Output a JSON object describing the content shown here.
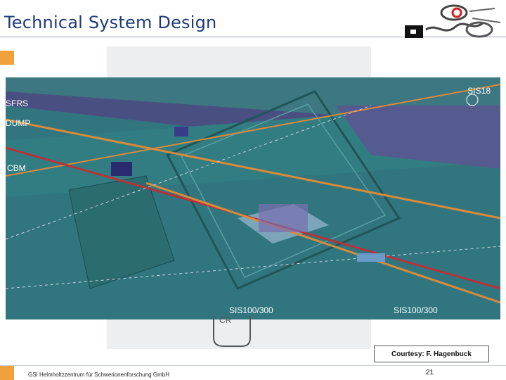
{
  "slide": {
    "title": "Technical System Design",
    "footer_org": "GSI Helmholtzzentrum für Schwerionenforschung GmbH",
    "page_number": "21",
    "courtesy": "Courtesy: F. Hagenbuck"
  },
  "drawing": {
    "labels": {
      "sis18": "SIS18",
      "sfrs": "SFRS",
      "dump": "DUMP",
      "cbm": "CBM",
      "sis100_left": "SIS100/300",
      "sis100_right": "SIS100/300",
      "cr": "CR"
    }
  },
  "colors": {
    "title": "#1d3a7a",
    "accent": "#f0a13b",
    "tunnel_teal": "#2f7a7e",
    "background_purple": "#4a4f82"
  },
  "icons": {
    "logo": "gsi-logo-icon"
  }
}
